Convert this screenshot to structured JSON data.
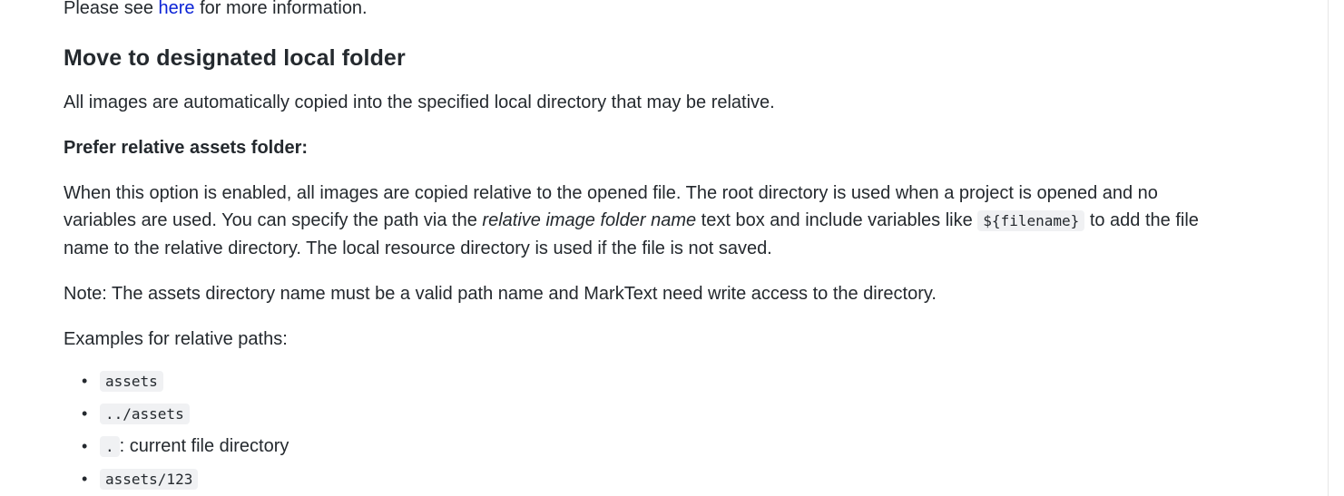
{
  "intro": {
    "before_link": "Please see ",
    "link_text": "here",
    "after_link": " for more information."
  },
  "section": {
    "heading": "Move to designated local folder",
    "para1": "All images are automatically copied into the specified local directory that may be relative.",
    "subheading": "Prefer relative assets folder:",
    "para2": {
      "part1": "When this option is enabled, all images are copied relative to the opened file. The root directory is used when a project is opened and no variables are used. You can specify the path via the ",
      "em_text": "relative image folder name",
      "part2": " text box and include variables like ",
      "code_text": "${filename}",
      "part3": " to add the file name to the relative directory. The local resource directory is used if the file is not saved."
    },
    "note": "Note: The assets directory name must be a valid path name and MarkText need write access to the directory.",
    "examples_label": "Examples for relative paths:",
    "examples": [
      {
        "code": "assets",
        "text": ""
      },
      {
        "code": "../assets",
        "text": ""
      },
      {
        "code": ".",
        "text": ": current file directory"
      },
      {
        "code": "assets/123",
        "text": ""
      }
    ]
  }
}
